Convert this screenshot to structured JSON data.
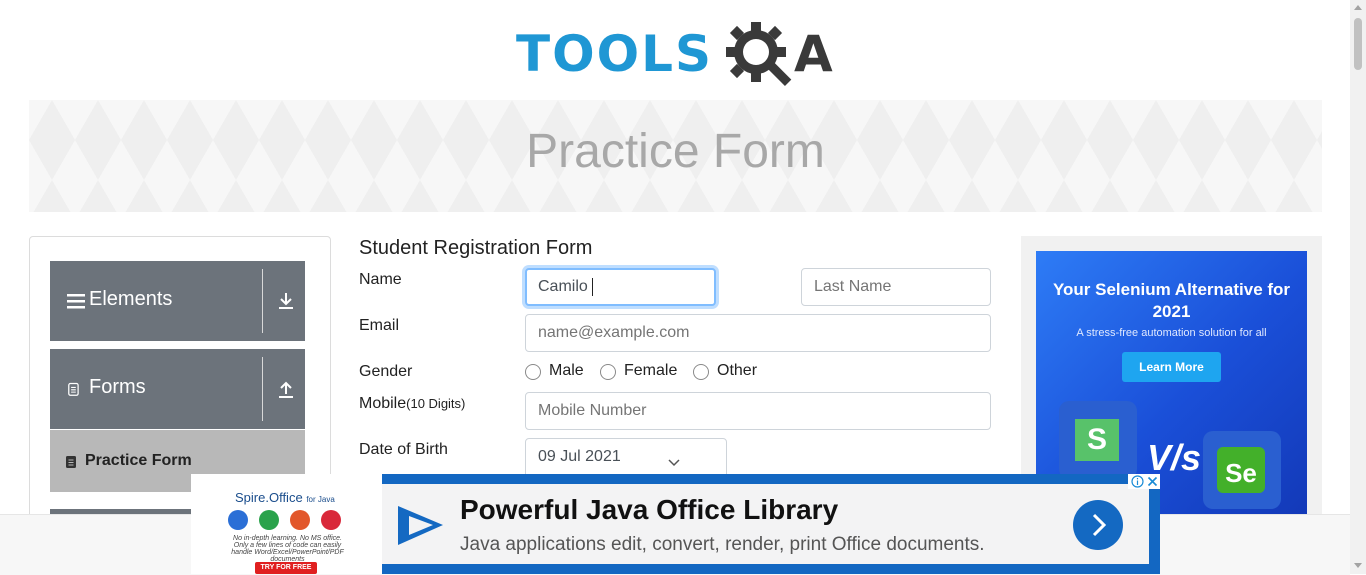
{
  "logo": {
    "text": "TOOLS",
    "accent": "A",
    "colors": {
      "primary": "#1f97d4",
      "dark": "#3a3a3a"
    }
  },
  "header": {
    "title": "Practice Form"
  },
  "sidebar": {
    "groups": [
      {
        "label": "Elements",
        "icon": "hamburger-icon",
        "toggle_icon": "download-arrow-icon"
      },
      {
        "label": "Forms",
        "icon": "document-icon",
        "toggle_icon": "upload-arrow-icon"
      }
    ],
    "active_item": {
      "label": "Practice Form",
      "icon": "document-icon"
    }
  },
  "form": {
    "title": "Student Registration Form",
    "name": {
      "label": "Name",
      "first_value": "Camilo",
      "last_placeholder": "Last Name"
    },
    "email": {
      "label": "Email",
      "placeholder": "name@example.com"
    },
    "gender": {
      "label": "Gender",
      "options": [
        "Male",
        "Female",
        "Other"
      ]
    },
    "mobile": {
      "label": "Mobile",
      "hint": "(10 Digits)",
      "placeholder": "Mobile Number"
    },
    "dob": {
      "label": "Date of Birth",
      "value": "09 Jul 2021"
    }
  },
  "ad_right": {
    "headline": "Your Selenium Alternative for 2021",
    "subtext": "A stress-free automation solution for all",
    "button": "Learn More",
    "vs": "V/s",
    "logo_left": "S",
    "logo_right": "Se"
  },
  "ad_bottom": {
    "brand": "Spire.Office",
    "brand_suffix": "for Java",
    "description": "No in-depth learning. No MS office. Only a few lines of code can easily handle Word/Excel/PowerPoint/PDF documents",
    "try": "TRY FOR FREE",
    "title": "Powerful Java Office Library",
    "text": "Java applications edit, convert, render, print Office documents.",
    "info_icon": "info-icon",
    "close_icon": "close-icon"
  }
}
